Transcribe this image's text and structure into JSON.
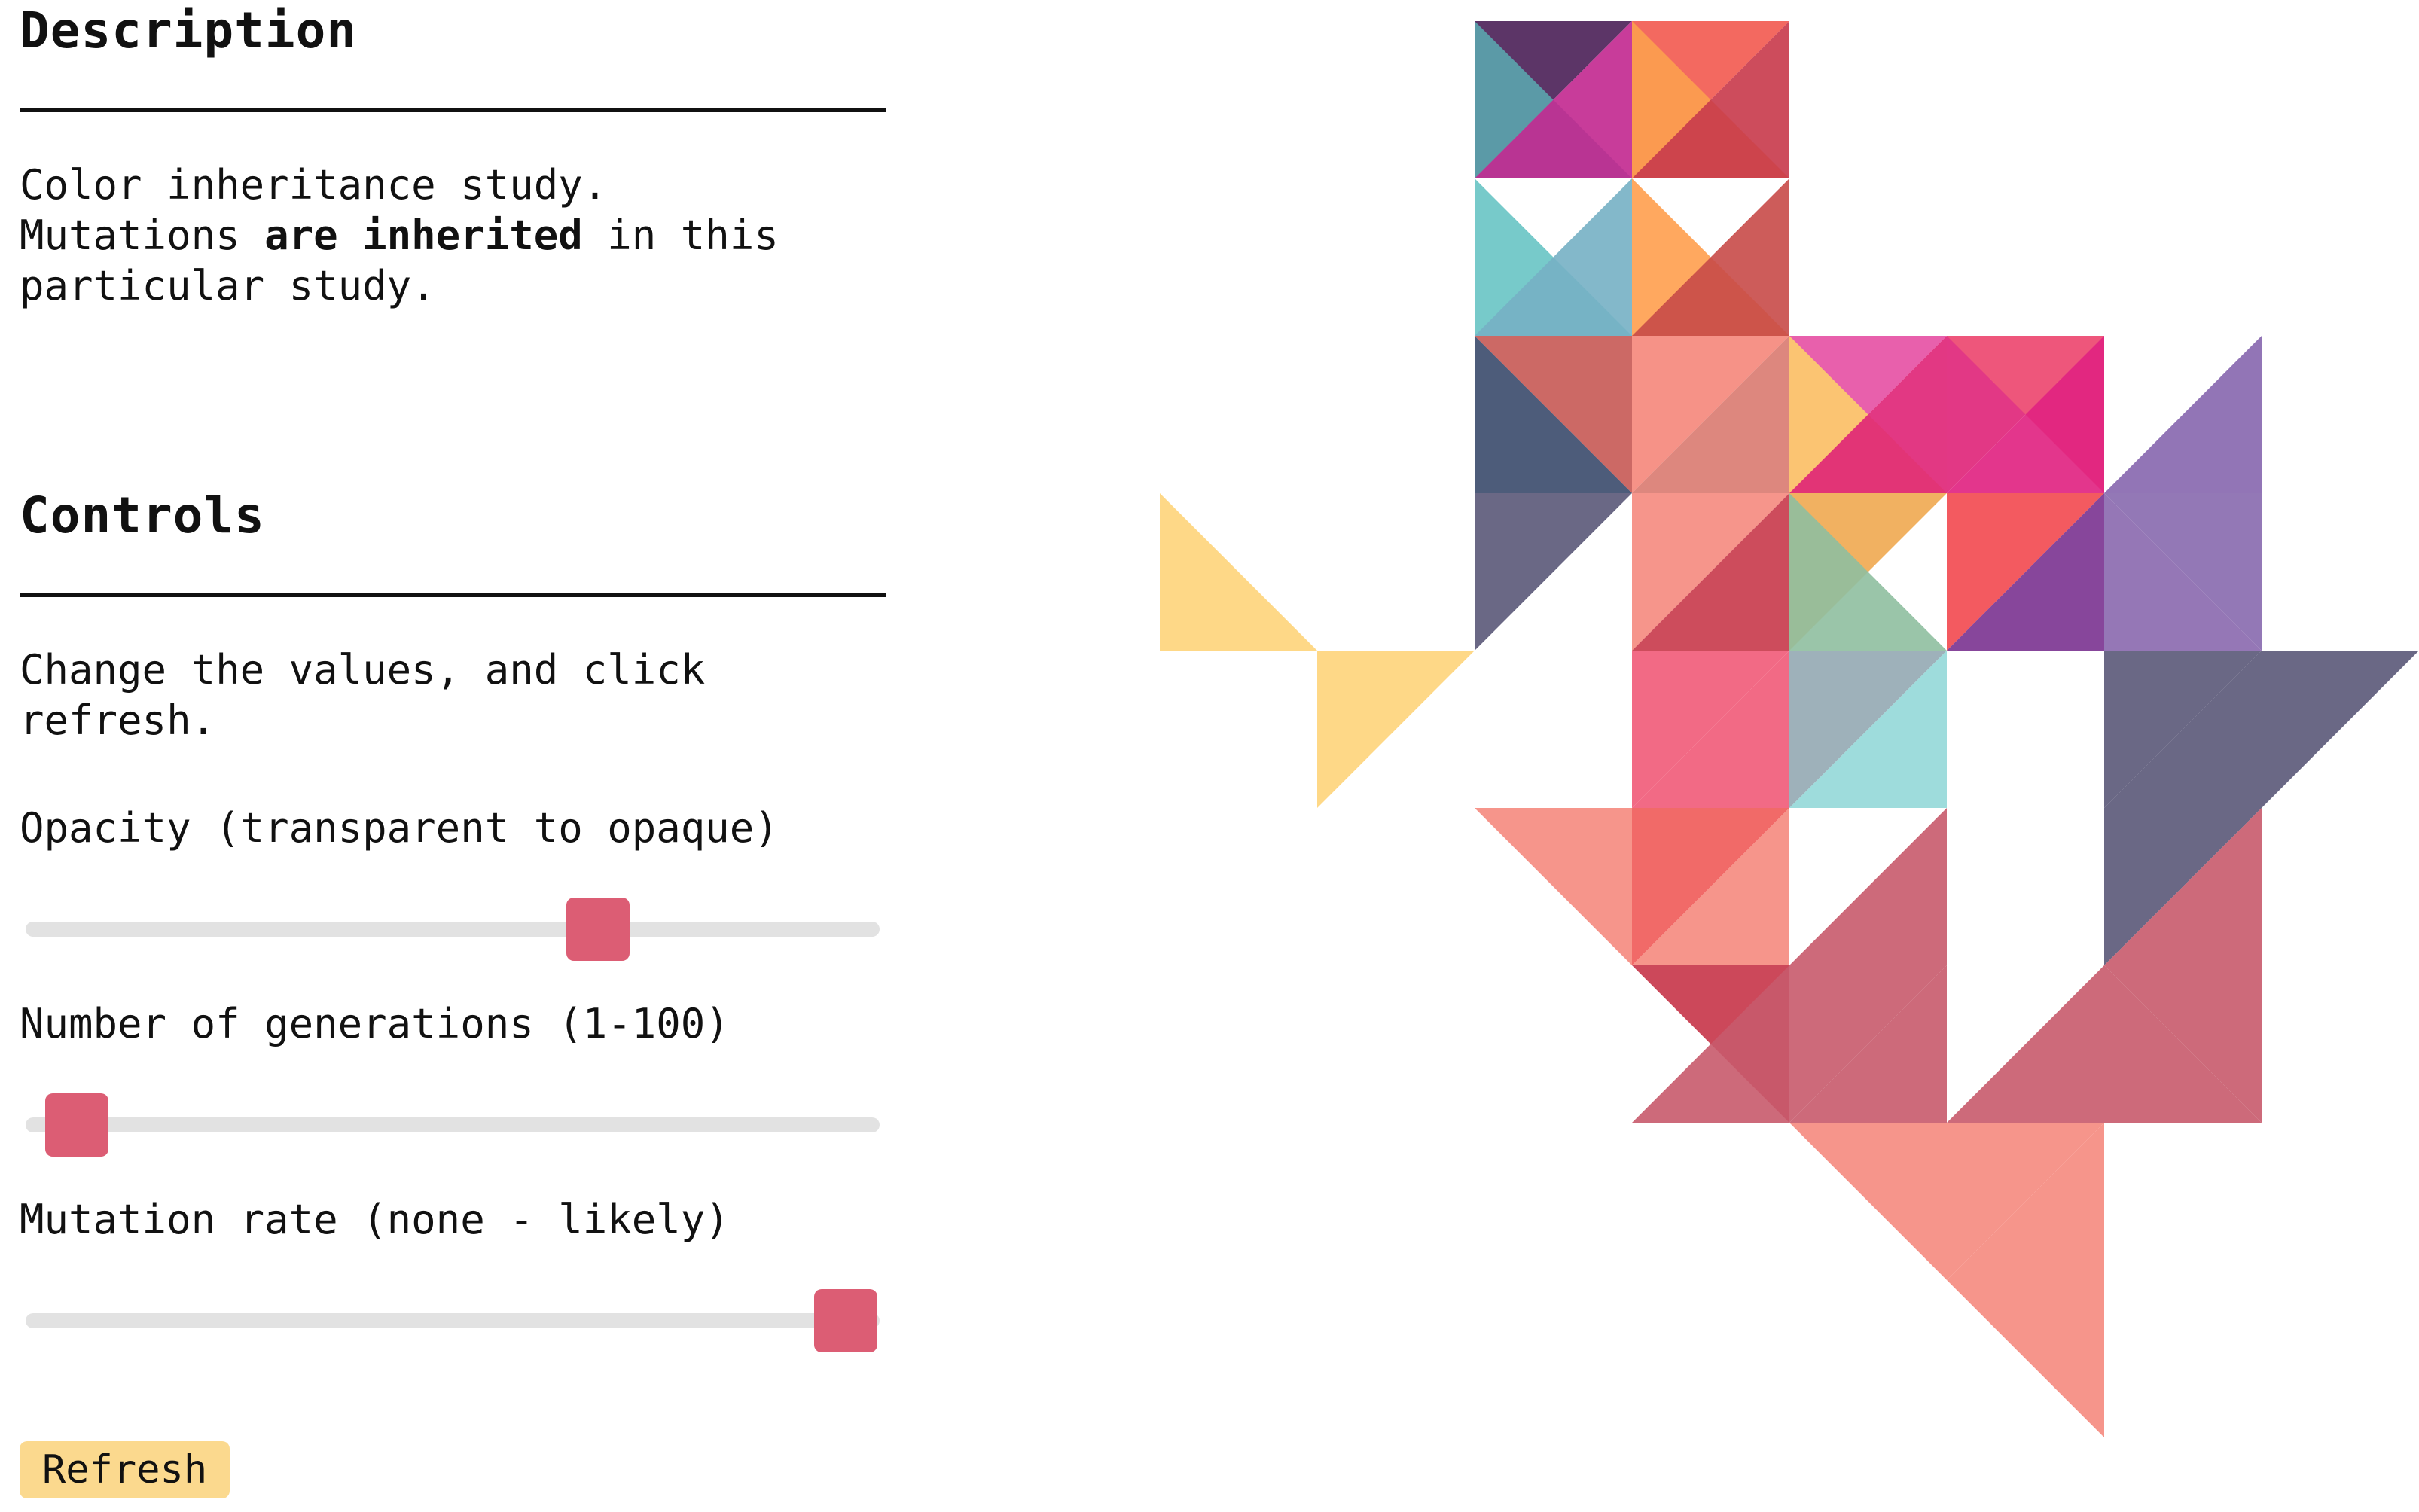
{
  "description": {
    "heading": "Description",
    "line1": "Color inheritance study.",
    "line2_before": "Mutations ",
    "line2_bold": "are inherited",
    "line2_after": " in this",
    "line3": "particular study."
  },
  "controls": {
    "heading": "Controls",
    "instruction_line1": "Change the values, and click",
    "instruction_line2": "refresh.",
    "opacity": {
      "label": "Opacity (transparent to opaque)",
      "value_fraction": 0.67
    },
    "generations": {
      "label": "Number of generations (1-100)",
      "value_fraction": 0.06
    },
    "mutation": {
      "label": "Mutation rate (none - likely)",
      "value_fraction": 0.96
    },
    "refresh_label": "Refresh"
  },
  "colors": {
    "text": "#111111",
    "slider_track": "#e2e2e2",
    "slider_thumb": "#dc5d74",
    "refresh_button": "#fbd98e"
  },
  "artwork": {
    "columns": 8,
    "rows": 9,
    "tiles": [
      {
        "col": 2,
        "row": 0,
        "corner": "NW",
        "color": "#4a1f57"
      },
      {
        "col": 2,
        "row": 0,
        "corner": "SW",
        "color": "#5ba5ae"
      },
      {
        "col": 2,
        "row": 0,
        "corner": "SE",
        "color": "#c2278f"
      },
      {
        "col": 3,
        "row": 0,
        "corner": "NW",
        "color": "#f2594f"
      },
      {
        "col": 3,
        "row": 0,
        "corner": "SW",
        "color": "#fca04f"
      },
      {
        "col": 3,
        "row": 0,
        "corner": "SE",
        "color": "#c8384a"
      },
      {
        "col": 2,
        "row": 1,
        "corner": "SW",
        "color": "#68c4c4"
      },
      {
        "col": 2,
        "row": 1,
        "corner": "SE",
        "color": "#76b0c4"
      },
      {
        "col": 3,
        "row": 1,
        "corner": "SW",
        "color": "#ff9e4e"
      },
      {
        "col": 3,
        "row": 1,
        "corner": "SE",
        "color": "#c84a48"
      },
      {
        "col": 2,
        "row": 2,
        "corner": "NE",
        "color": "#c75954"
      },
      {
        "col": 2,
        "row": 2,
        "corner": "SW",
        "color": "#3a4a6c"
      },
      {
        "col": 3,
        "row": 2,
        "corner": "NW",
        "color": "#f5867a"
      },
      {
        "col": 3,
        "row": 2,
        "corner": "SE",
        "color": "#d97a70"
      },
      {
        "col": 4,
        "row": 2,
        "corner": "NW",
        "color": "#e54fa3"
      },
      {
        "col": 4,
        "row": 2,
        "corner": "SW",
        "color": "#fdcf6c"
      },
      {
        "col": 4,
        "row": 2,
        "corner": "SE",
        "color": "#df2275"
      },
      {
        "col": 5,
        "row": 2,
        "corner": "NW",
        "color": "#df2278"
      },
      {
        "col": 5,
        "row": 2,
        "corner": "NE",
        "color": "#f05a7a"
      },
      {
        "col": 5,
        "row": 2,
        "corner": "SE",
        "color": "#e02080"
      },
      {
        "col": 6,
        "row": 2,
        "corner": "SE",
        "color": "#8666ae"
      },
      {
        "col": 2,
        "row": 3,
        "corner": "NW",
        "color": "#5a5878"
      },
      {
        "col": 3,
        "row": 3,
        "corner": "NW",
        "color": "#f58a7e"
      },
      {
        "col": 3,
        "row": 3,
        "corner": "SE",
        "color": "#c8394a"
      },
      {
        "col": 4,
        "row": 3,
        "corner": "NW",
        "color": "#f0a850"
      },
      {
        "col": 4,
        "row": 3,
        "corner": "SW",
        "color": "#8fbfa0"
      },
      {
        "col": 5,
        "row": 3,
        "corner": "NW",
        "color": "#f2484f"
      },
      {
        "col": 5,
        "row": 3,
        "corner": "SE",
        "color": "#7a3290"
      },
      {
        "col": 6,
        "row": 3,
        "corner": "NE",
        "color": "#8769ae"
      },
      {
        "col": 6,
        "row": 3,
        "corner": "SW",
        "color": "#8a68ae"
      },
      {
        "col": 0,
        "row": 3,
        "corner": "SW",
        "color": "#fed47a"
      },
      {
        "col": 1,
        "row": 4,
        "corner": "NW",
        "color": "#fed47a"
      },
      {
        "col": 3,
        "row": 4,
        "corner": "NW",
        "color": "#f15a78"
      },
      {
        "col": 3,
        "row": 4,
        "corner": "SE",
        "color": "#f15a78"
      },
      {
        "col": 4,
        "row": 4,
        "corner": "NW",
        "color": "#93a8b2"
      },
      {
        "col": 4,
        "row": 4,
        "corner": "SE",
        "color": "#93d8d8"
      },
      {
        "col": 6,
        "row": 4,
        "corner": "NW",
        "color": "#5a5878"
      },
      {
        "col": 6,
        "row": 4,
        "corner": "SE",
        "color": "#5a5878"
      },
      {
        "col": 7,
        "row": 4,
        "corner": "NW",
        "color": "#5a5878"
      },
      {
        "col": 2,
        "row": 5,
        "corner": "NE",
        "color": "#f58a7e"
      },
      {
        "col": 3,
        "row": 5,
        "corner": "NW",
        "color": "#f05a58"
      },
      {
        "col": 3,
        "row": 5,
        "corner": "SE",
        "color": "#f58a7e"
      },
      {
        "col": 4,
        "row": 5,
        "corner": "SE",
        "color": "#c85a6c"
      },
      {
        "col": 6,
        "row": 5,
        "corner": "NW",
        "color": "#5a5878"
      },
      {
        "col": 6,
        "row": 5,
        "corner": "SE",
        "color": "#c85a6c"
      },
      {
        "col": 3,
        "row": 6,
        "corner": "NE",
        "color": "#c73448"
      },
      {
        "col": 3,
        "row": 6,
        "corner": "SE",
        "color": "#c85a6c"
      },
      {
        "col": 4,
        "row": 6,
        "corner": "NW",
        "color": "#c85a6c"
      },
      {
        "col": 4,
        "row": 6,
        "corner": "SE",
        "color": "#c85a6c"
      },
      {
        "col": 5,
        "row": 6,
        "corner": "SE",
        "color": "#c85a6c"
      },
      {
        "col": 6,
        "row": 6,
        "corner": "SW",
        "color": "#c85a6c"
      },
      {
        "col": 6,
        "row": 6,
        "corner": "NE",
        "color": "#c85a6c"
      },
      {
        "col": 4,
        "row": 7,
        "corner": "NE",
        "color": "#f58a7e"
      },
      {
        "col": 5,
        "row": 7,
        "corner": "NW",
        "color": "#f58a7e"
      },
      {
        "col": 5,
        "row": 7,
        "corner": "SE",
        "color": "#f58a7e"
      },
      {
        "col": 5,
        "row": 8,
        "corner": "NE",
        "color": "#f58a7e"
      }
    ]
  }
}
